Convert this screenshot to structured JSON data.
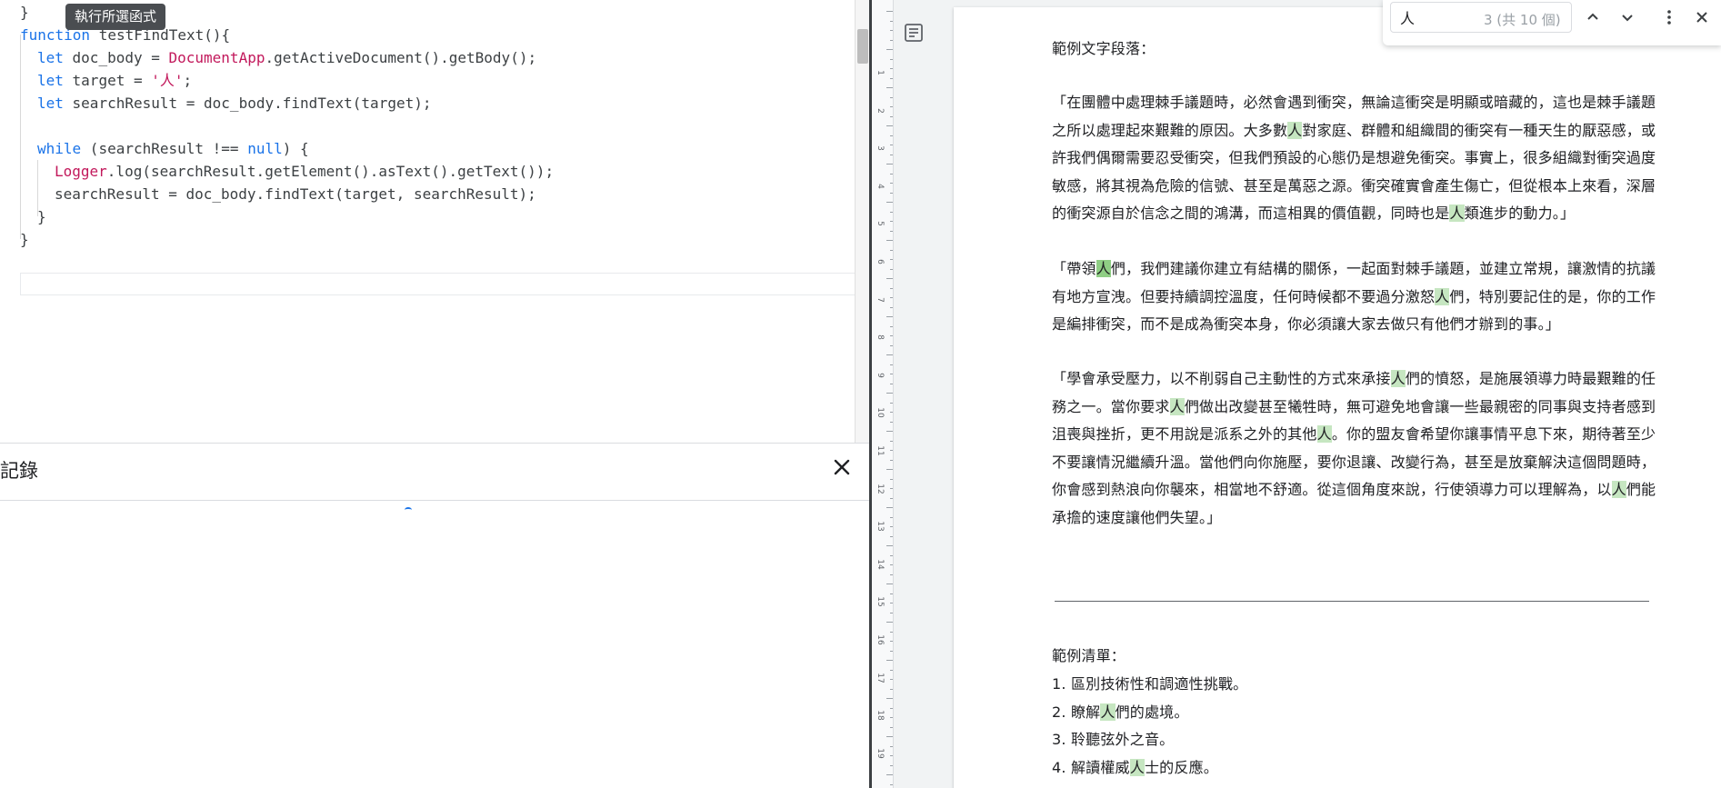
{
  "editor": {
    "tooltip": "執行所選函式",
    "code": {
      "line0": "}",
      "line1_kw": "function",
      "line1_rest": " testFindText(){",
      "line2_kw": "let",
      "line2_a": " doc_body = ",
      "line2_cls": "DocumentApp",
      "line2_b": ".getActiveDocument().getBody();",
      "line3_kw": "let",
      "line3_a": " target = ",
      "line3_str": "'人'",
      "line3_b": ";",
      "line4_kw": "let",
      "line4_a": " searchResult = doc_body.findText(target);",
      "line6_kw": "while",
      "line6_a": " (searchResult !== ",
      "line6_kw2": "null",
      "line6_b": ") {",
      "line7_cls": "Logger",
      "line7_a": ".log(searchResult.getElement().asText().getText());",
      "line8": "searchResult = doc_body.findText(target, searchResult);",
      "line9": "}",
      "line10": "}"
    }
  },
  "log": {
    "title": "記錄",
    "close_icon": "close-icon"
  },
  "find": {
    "query": "人",
    "count": "3 (共 10 個)",
    "prev_icon": "chevron-up-icon",
    "next_icon": "chevron-down-icon",
    "more_icon": "more-vert-icon",
    "close_icon": "close-icon"
  },
  "ruler": [
    "1",
    "2",
    "3",
    "4",
    "5",
    "6",
    "7",
    "8",
    "9",
    "10",
    "11",
    "12",
    "13",
    "14",
    "15",
    "16",
    "17",
    "18",
    "19"
  ],
  "doc": {
    "heading1": "範例文字段落：",
    "p1": [
      [
        "「在團體中處理棘手議題時，必然會遇到衝突，無論這衝突是明顯或暗藏的，這也是棘手議題"
      ],
      [
        "之所以處理起來艱難的原因。大多數",
        "人",
        "對家庭、群體和組織間的衝突有一種天生的厭惡感，或"
      ],
      [
        "許我們偶爾需要忍受衝突，但我們預設的心態仍是想避免衝突。事實上，很多組織對衝突過度"
      ],
      [
        "敏感，將其視為危險的信號、甚至是萬惡之源。衝突確實會產生傷亡，但從根本上來看，深層"
      ],
      [
        "的衝突源自於信念之間的鴻溝，而這相異的價值觀，同時也是",
        "人",
        "類進步的動力。」"
      ]
    ],
    "p2": [
      [
        "「帶領",
        "人",
        "們，我們建議你建立有結構的關係，一起面對棘手議題，並建立常規，讓激情的抗議"
      ],
      [
        "有地方宣洩。但要持續調控溫度，任何時候都不要過分激怒",
        "人",
        "們，特別要記住的是，你的工作"
      ],
      [
        "是編排衝突，而不是成為衝突本身，你必須讓大家去做只有他們才辦到的事。」"
      ]
    ],
    "p3": [
      [
        "「學會承受壓力，以不削弱自己主動性的方式來承接",
        "人",
        "們的憤怒，是施展領導力時最艱難的任"
      ],
      [
        "務之一。當你要求",
        "人",
        "們做出改變甚至犧牲時，無可避免地會讓一些最親密的同事與支持者感到"
      ],
      [
        "沮喪與挫折，更不用說是派系之外的其他",
        "人",
        "。你的盟友會希望你讓事情平息下來，期待著至少"
      ],
      [
        "不要讓情況繼續升溫。當他們向你施壓，要你退讓、改變行為，甚至是放棄解決這個問題時，"
      ],
      [
        "你會感到熱浪向你襲來，相當地不舒適。從這個角度來說，行使領導力可以理解為，以",
        "人",
        "們能"
      ],
      [
        "承擔的速度讓他們失望。」"
      ]
    ],
    "heading2": "範例清單：",
    "list": [
      [
        "1. 區別技術性和調適性挑戰。"
      ],
      [
        "2. 瞭解",
        "人",
        "們的處境。"
      ],
      [
        "3. 聆聽弦外之音。"
      ],
      [
        "4. 解讀權威",
        "人",
        "士的反應。"
      ]
    ]
  }
}
